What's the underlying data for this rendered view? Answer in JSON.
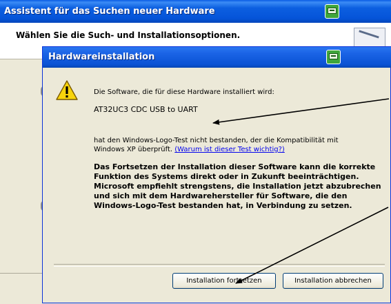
{
  "outer_window": {
    "title": "Assistent für das Suchen neuer Hardware",
    "subtitle": "Wählen Sie die Such- und Installationsoptionen."
  },
  "dialog": {
    "title": "Hardwareinstallation",
    "intro": "Die Software, die für diese Hardware installiert wird:",
    "device_name": "AT32UC3 CDC USB to UART",
    "logo_test_line1": "hat den Windows-Logo-Test nicht bestanden, der die Kompatibilität mit",
    "logo_test_line2_prefix": "Windows XP überprüft. ",
    "why_link": "(Warum ist dieser Test wichtig?)",
    "warning_lines": [
      "Das Fortsetzen der Installation dieser Software kann die korrekte",
      "Funktion des Systems direkt oder in Zukunft beeinträchtigen.",
      "Microsoft empfiehlt strengstens, die Installation jetzt abzubrechen",
      "und sich mit dem Hardwarehersteller für Software, die den",
      "Windows-Logo-Test bestanden hat, in Verbindung zu setzen."
    ],
    "continue_button": "Installation fortsetzen",
    "abort_button": "Installation abbrechen"
  },
  "icons": {
    "warning": "warning-icon",
    "titlebar": "hardware-wizard-icon"
  },
  "colors": {
    "title_bar": "#0554d9",
    "dialog_bg": "#ece9d8",
    "link": "#0000ee",
    "annotation_arrow": "#000000"
  }
}
